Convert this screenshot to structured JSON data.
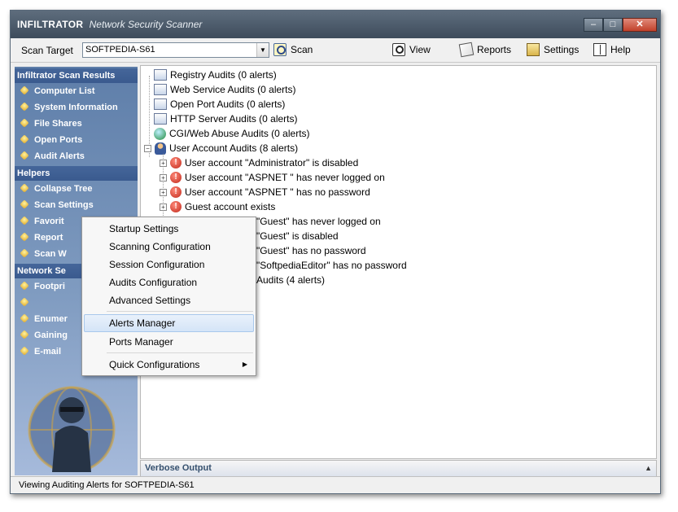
{
  "window": {
    "app_name": "INFILTRATOR",
    "subtitle": "Network Security Scanner",
    "minimize": "–",
    "maximize": "□",
    "close": "✕"
  },
  "toolbar": {
    "scan_target_label": "Scan Target",
    "scan_target_value": "SOFTPEDIA-S61",
    "scan_label": "Scan",
    "view_label": "View",
    "reports_label": "Reports",
    "settings_label": "Settings",
    "help_label": "Help"
  },
  "sidebar": {
    "results_header": "Infiltrator Scan Results",
    "results_items": [
      "Computer List",
      "System Information",
      "File Shares",
      "Open Ports",
      "Audit Alerts"
    ],
    "helpers_header": "Helpers",
    "helpers_items": [
      "Collapse Tree",
      "Scan Settings",
      "Favorit",
      "Report",
      "Scan W"
    ],
    "network_header": "Network Se",
    "network_items": [
      "Footpri",
      "",
      "Enumer",
      "Gaining",
      "E-mail"
    ]
  },
  "tree": {
    "items": [
      {
        "label": "Registry Audits (0 alerts)",
        "icon": "registry-icon"
      },
      {
        "label": "Web Service Audits (0 alerts)",
        "icon": "web-service-icon"
      },
      {
        "label": "Open Port Audits (0 alerts)",
        "icon": "port-icon"
      },
      {
        "label": "HTTP Server Audits (0 alerts)",
        "icon": "http-server-icon"
      },
      {
        "label": "CGI/Web Abuse Audits (0 alerts)",
        "icon": "globe-icon"
      },
      {
        "label": "User Account Audits (8 alerts)",
        "icon": "user-icon"
      }
    ],
    "alerts": [
      "User account \"Administrator\" is disabled",
      "User account \"ASPNET \" has never logged on",
      "User account \"ASPNET \" has no password",
      "Guest account exists",
      "\"Guest\" has never logged on",
      "\"Guest\" is disabled",
      "\"Guest\" has no password",
      "\"SoftpediaEditor\" has no password"
    ],
    "last_item": "Audits (4 alerts)"
  },
  "context_menu": {
    "items": [
      "Startup Settings",
      "Scanning Configuration",
      "Session Configuration",
      "Audits Configuration",
      "Advanced Settings"
    ],
    "alerts_manager": "Alerts Manager",
    "ports_manager": "Ports Manager",
    "quick_config": "Quick Configurations"
  },
  "verbose": {
    "label": "Verbose Output"
  },
  "status": {
    "text": "Viewing Auditing Alerts for SOFTPEDIA-S61"
  }
}
